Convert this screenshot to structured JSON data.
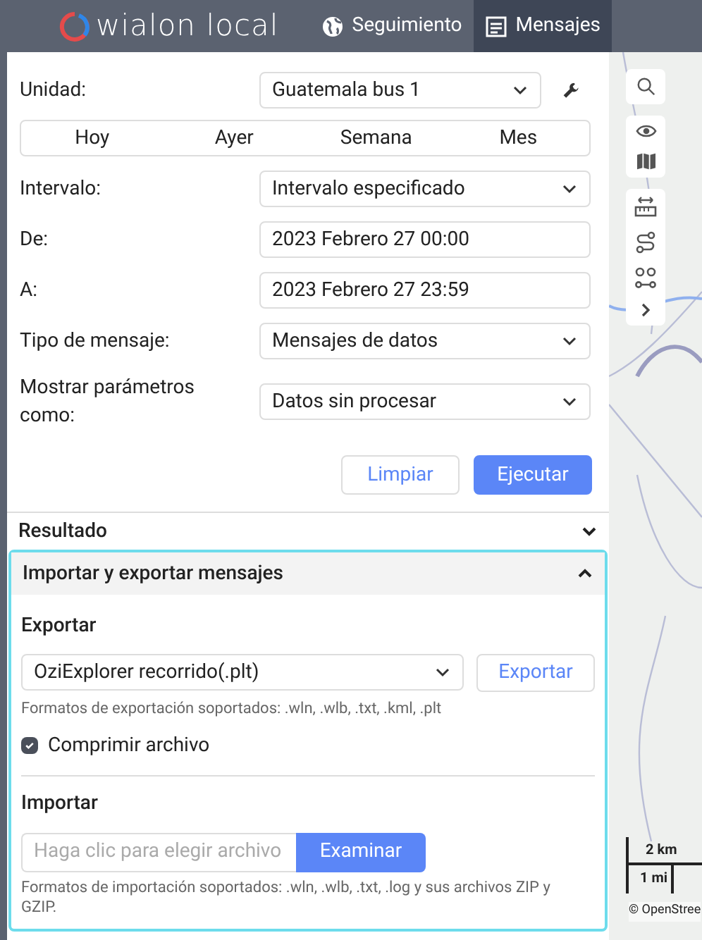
{
  "header": {
    "logo": "wialon local",
    "nav": [
      {
        "label": "Seguimiento",
        "selected": false
      },
      {
        "label": "Mensajes",
        "selected": true
      }
    ]
  },
  "form": {
    "unit": {
      "label": "Unidad:",
      "value": "Guatemala bus 1"
    },
    "periods": [
      {
        "label": "Hoy",
        "selected": false
      },
      {
        "label": "Ayer",
        "selected": false
      },
      {
        "label": "Semana",
        "selected": false
      },
      {
        "label": "Mes",
        "selected": false
      }
    ],
    "fields": [
      {
        "kind": "select",
        "label": "Intervalo:",
        "value": "Intervalo especificado"
      },
      {
        "kind": "input",
        "label": "De:",
        "value": "2023 Febrero 27 00:00"
      },
      {
        "kind": "input",
        "label": "A:",
        "value": "2023 Febrero 27 23:59"
      },
      {
        "kind": "select",
        "label": "Tipo de mensaje:",
        "value": "Mensajes de datos"
      },
      {
        "kind": "select",
        "label": "Mostrar parámetros como:",
        "value": "Datos sin procesar"
      }
    ],
    "buttons": [
      {
        "label": "Limpiar",
        "kind": "secondary"
      },
      {
        "label": "Ejecutar",
        "kind": "primary"
      }
    ]
  },
  "sections": [
    {
      "title": "Resultado",
      "expanded": false
    },
    {
      "title": "Importar y exportar mensajes",
      "expanded": true
    }
  ],
  "export": {
    "title": "Exportar",
    "format": "OziExplorer recorrido(.plt)",
    "button": "Exportar",
    "hint": "Formatos de exportación soportados: .wln, .wlb, .txt, .kml, .plt",
    "compress": {
      "label": "Comprimir archivo",
      "checked": true
    }
  },
  "import": {
    "title": "Importar",
    "placeholder": "Haga clic para elegir archivo",
    "button": "Examinar",
    "hint": "Formatos de importación soportados: .wln, .wlb, .txt, .log y sus archivos ZIP y GZIP."
  },
  "map": {
    "scale": [
      "2 km",
      "1 mi"
    ],
    "attribution": "© OpenStree"
  }
}
